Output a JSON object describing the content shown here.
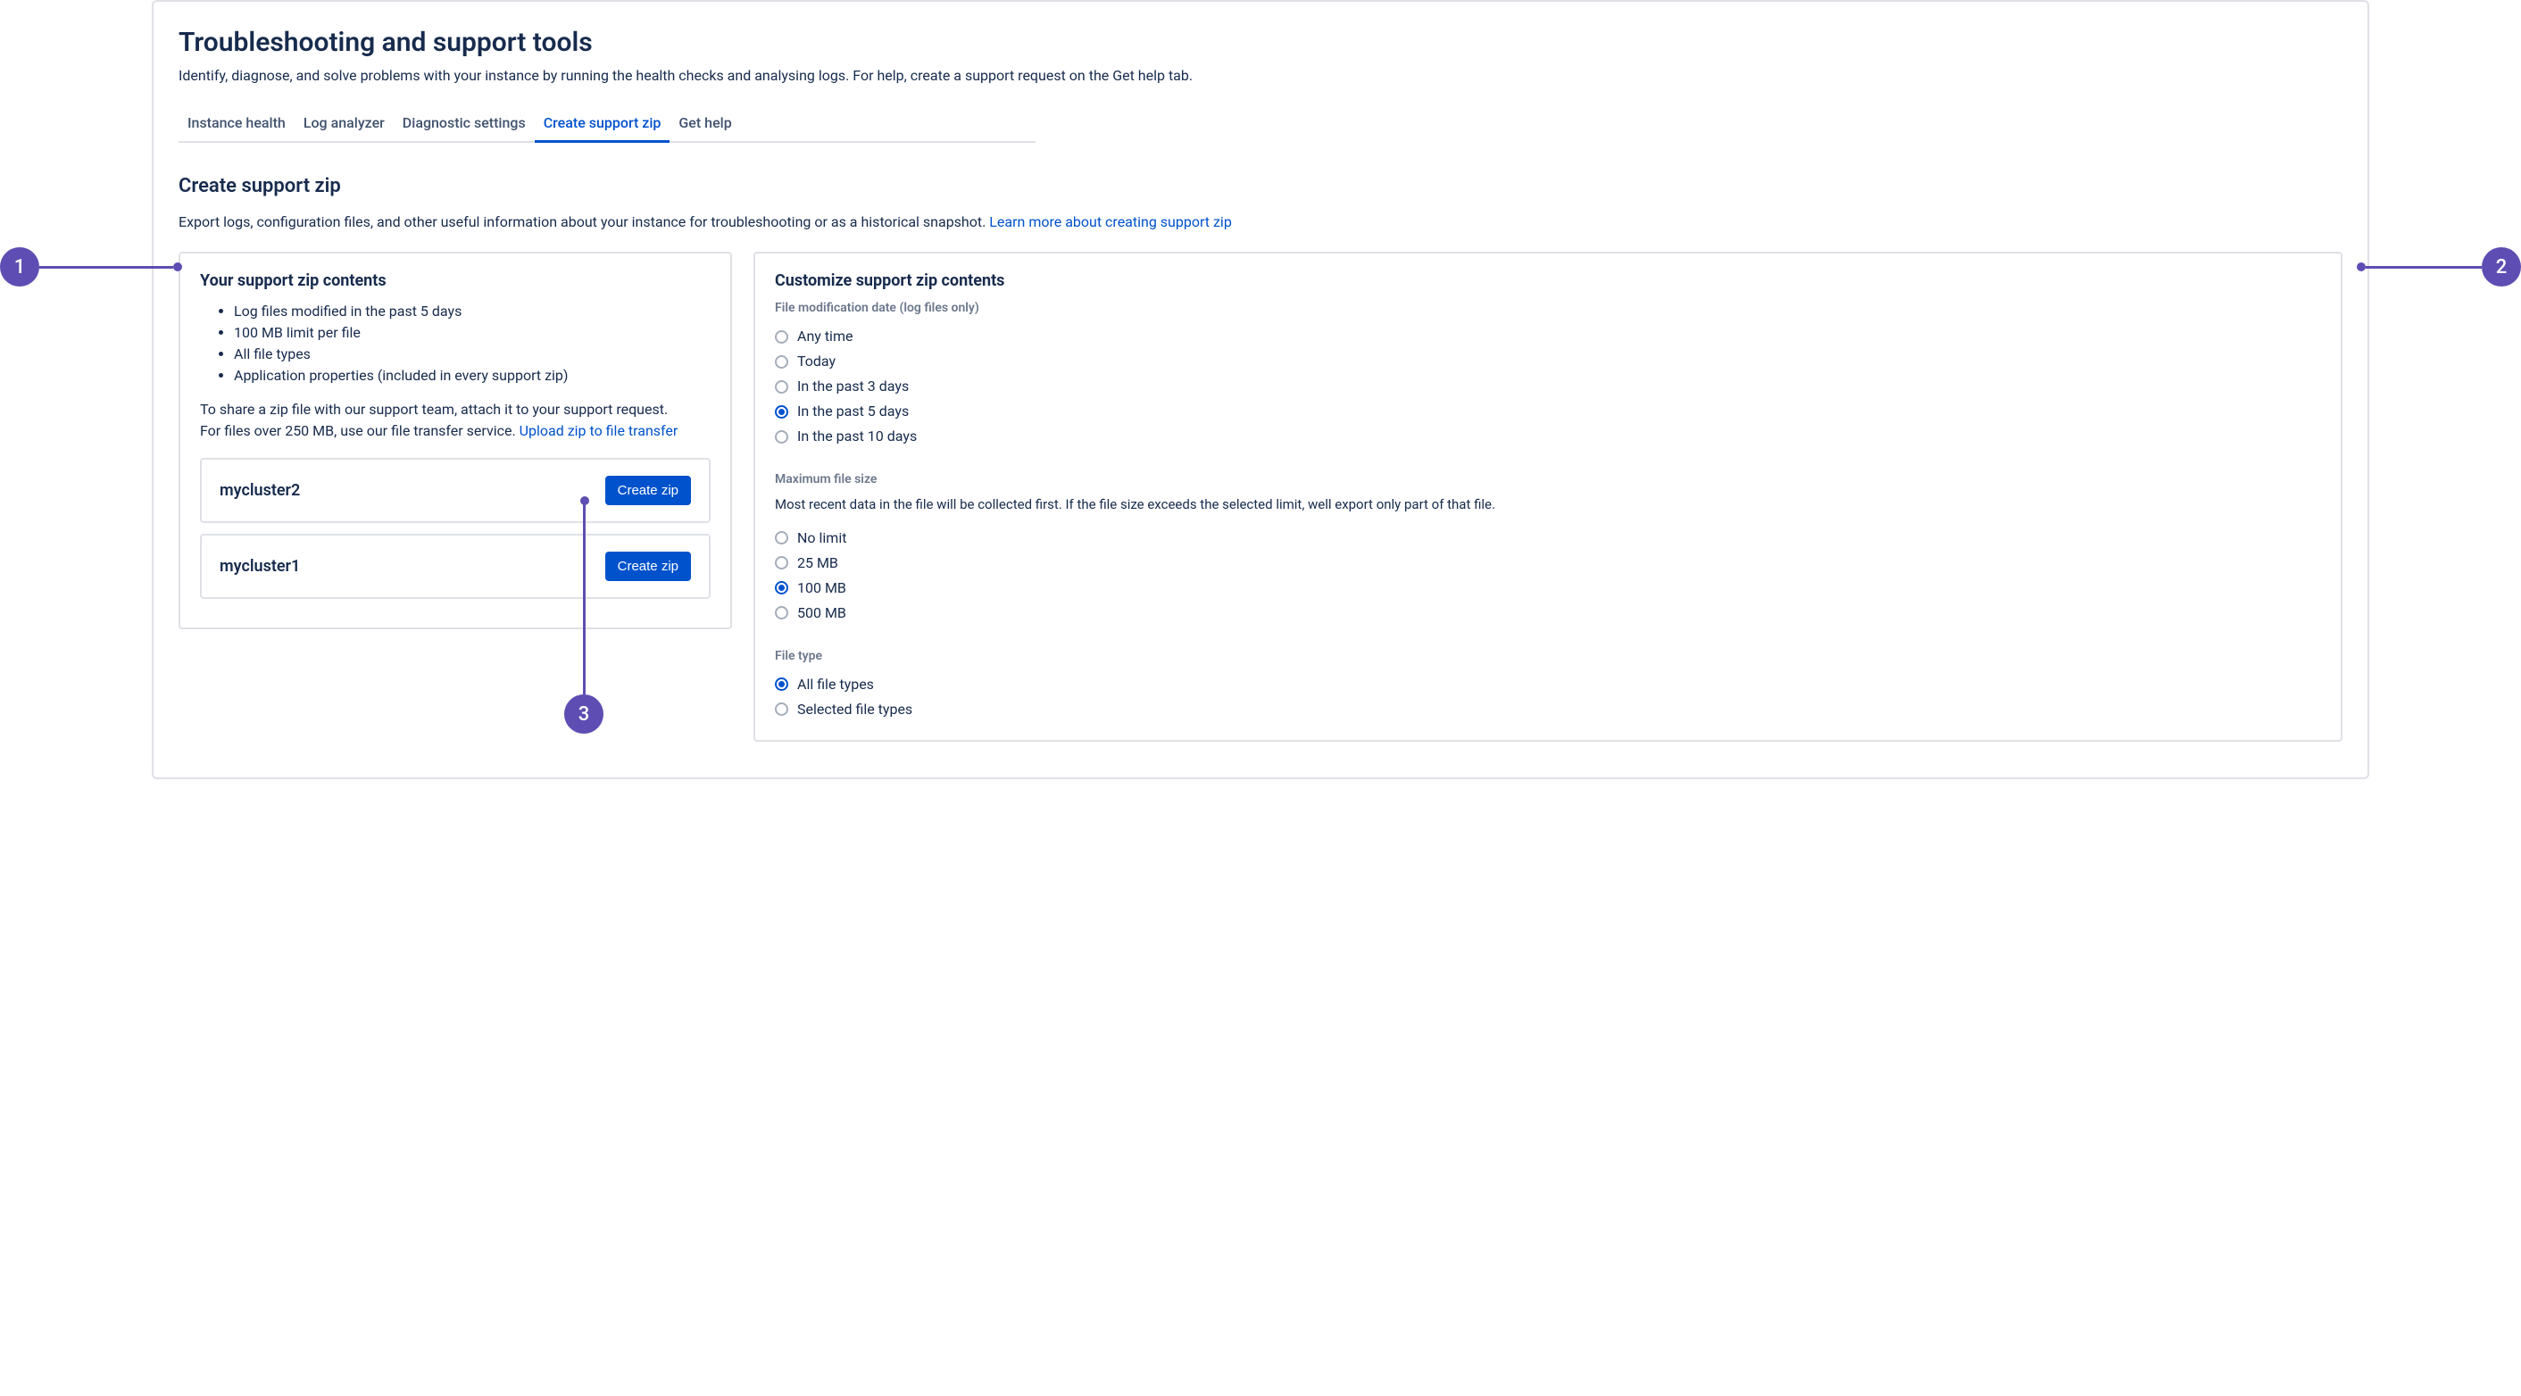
{
  "page": {
    "title": "Troubleshooting and support tools",
    "description": "Identify, diagnose, and solve problems with your instance by running the health checks and analysing logs. For help, create a support request on the Get help tab."
  },
  "tabs": {
    "items": [
      {
        "label": "Instance health",
        "active": false
      },
      {
        "label": "Log analyzer",
        "active": false
      },
      {
        "label": "Diagnostic settings",
        "active": false
      },
      {
        "label": "Create support zip",
        "active": true
      },
      {
        "label": "Get help",
        "active": false
      }
    ]
  },
  "section": {
    "title": "Create support zip",
    "description": "Export logs, configuration files, and other useful information about your instance for troubleshooting or as a historical snapshot. ",
    "learn_more": "Learn more about creating support zip"
  },
  "contents_card": {
    "title": "Your support zip contents",
    "summary": [
      "Log files modified in the past 5 days",
      "100 MB limit per file",
      "All file types",
      "Application properties (included in every support zip)"
    ],
    "share_line1": "To share a zip file with our support team, attach it to your support request.",
    "share_line2_prefix": "For files over 250 MB, use our file transfer service. ",
    "share_link": "Upload zip to file transfer",
    "clusters": [
      {
        "name": "mycluster2",
        "button": "Create zip"
      },
      {
        "name": "mycluster1",
        "button": "Create zip"
      }
    ]
  },
  "customize_card": {
    "title": "Customize support zip contents",
    "mod_date": {
      "label": "File modification date (log files only)",
      "options": [
        {
          "label": "Any time",
          "checked": false
        },
        {
          "label": "Today",
          "checked": false
        },
        {
          "label": "In the past 3 days",
          "checked": false
        },
        {
          "label": "In the past 5 days",
          "checked": true
        },
        {
          "label": "In the past 10 days",
          "checked": false
        }
      ]
    },
    "max_size": {
      "label": "Maximum file size",
      "description": "Most recent data in the file will be collected first. If the file size exceeds the selected limit, well export only part of that file.",
      "options": [
        {
          "label": "No limit",
          "checked": false
        },
        {
          "label": "25 MB",
          "checked": false
        },
        {
          "label": "100 MB",
          "checked": true
        },
        {
          "label": "500 MB",
          "checked": false
        }
      ]
    },
    "file_type": {
      "label": "File type",
      "options": [
        {
          "label": "All file types",
          "checked": true
        },
        {
          "label": "Selected file types",
          "checked": false
        }
      ]
    }
  },
  "callouts": {
    "1": "1",
    "2": "2",
    "3": "3"
  }
}
